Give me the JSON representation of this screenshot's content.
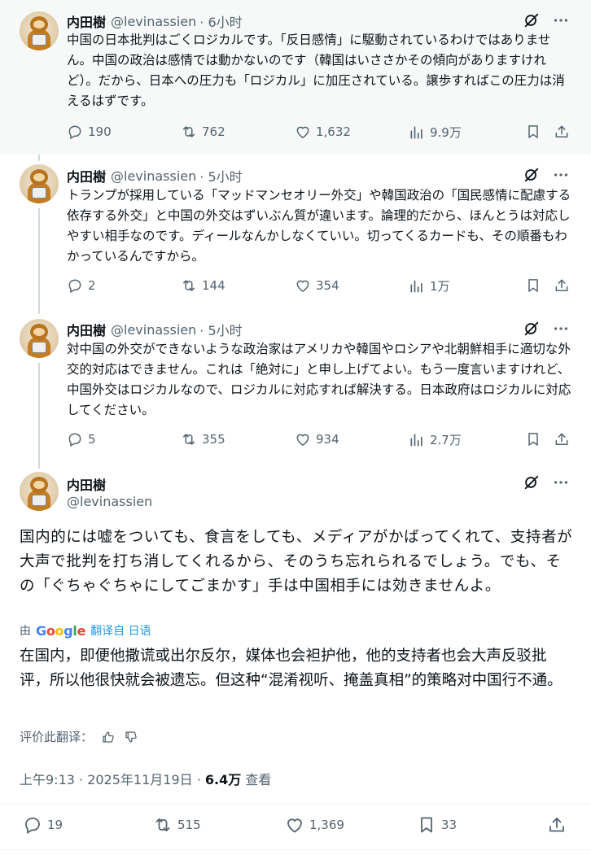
{
  "thread": [
    {
      "name": "内田樹",
      "handle": "@levinassien",
      "time": "· 6小时",
      "text": "中国の日本批判はごくロジカルです。「反日感情」に駆動されているわけではありません。中国の政治は感情では動かないのです（韓国はいささかその傾向がありますけれど）。だから、日本への圧力も「ロジカル」に加圧されている。譲歩すればこの圧力は消えるはずです。",
      "replies": "190",
      "reposts": "762",
      "likes": "1,632",
      "views": "9.9万"
    },
    {
      "name": "内田樹",
      "handle": "@levinassien",
      "time": "· 5小时",
      "text": "トランプが採用している「マッドマンセオリー外交」や韓国政治の「国民感情に配慮する依存する外交」と中国の外交はずいぶん質が違います。論理的だから、ほんとうは対応しやすい相手なのです。ディールなんかしなくていい。切ってくるカードも、その順番もわかっているんですから。",
      "replies": "2",
      "reposts": "144",
      "likes": "354",
      "views": "1万"
    },
    {
      "name": "内田樹",
      "handle": "@levinassien",
      "time": "· 5小时",
      "text": "対中国の外交ができないような政治家はアメリカや韓国やロシアや北朝鮮相手に適切な外交的対応はできません。これは「絶対に」と申し上げてよい。もう一度言いますけれど、中国外交はロジカルなので、ロジカルに対応すれば解決する。日本政府はロジカルに対応してください。",
      "replies": "5",
      "reposts": "355",
      "likes": "934",
      "views": "2.7万"
    }
  ],
  "main": {
    "name": "内田樹",
    "handle": "@levinassien",
    "text": "国内的には嘘をついても、食言をしても、メディアがかばってくれて、支持者が大声で批判を打ち消してくれるから、そのうち忘れられるでしょう。でも、その「ぐちゃぐちゃにしてごまかす」手は中国相手には効きませんよ。",
    "translate_prefix": "由",
    "google_letters": [
      "G",
      "o",
      "o",
      "g",
      "l",
      "e"
    ],
    "translate_link": "翻译自 日语",
    "translated_text": "在国内，即便他撒谎或出尔反尔，媒体也会袒护他，他的支持者也会大声反驳批评，所以他很快就会被遗忘。但这种“混淆视听、掩盖真相”的策略对中国行不通。",
    "rate_label": "评价此翻译：",
    "timestamp": "上午9:13 · 2025年11月19日 · ",
    "views": "6.4万",
    "views_label": " 查看",
    "replies": "19",
    "reposts": "515",
    "likes": "1,369",
    "bookmarks": "33"
  },
  "icons": [
    "grok-icon",
    "more-icon",
    "reply-icon",
    "repost-icon",
    "like-icon",
    "views-icon",
    "bookmark-icon",
    "share-icon",
    "thumbs-up-icon",
    "thumbs-down-icon"
  ],
  "colors": {
    "text": "#0f1419",
    "secondary": "#536471",
    "link": "#1d9bf0",
    "thread_line": "#cfd9de",
    "shaded_bg": "#f7f9f9"
  }
}
